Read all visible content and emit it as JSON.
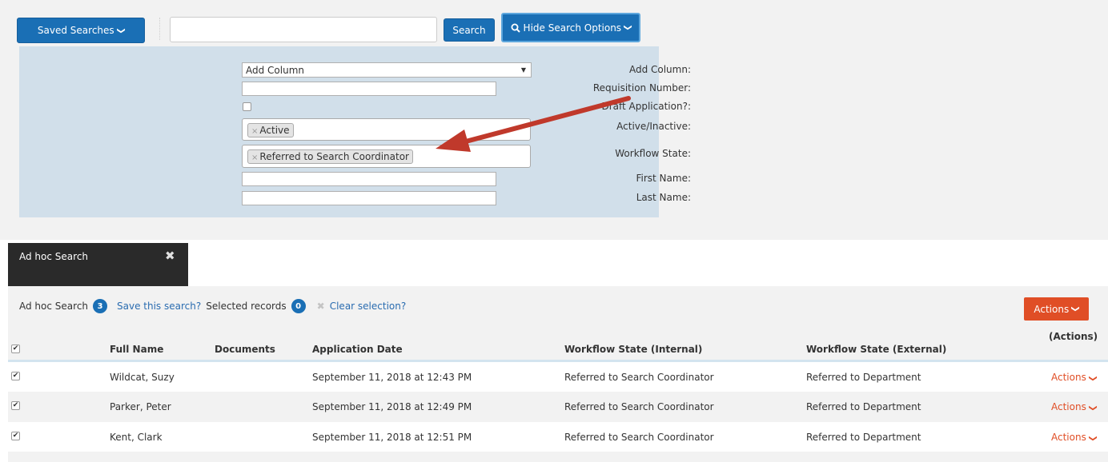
{
  "toolbar": {
    "saved_searches_label": "Saved Searches",
    "search_label": "Search",
    "hide_options_label": "Hide Search Options"
  },
  "search_panel": {
    "add_column_label": "Add Column:",
    "add_column_value": "Add Column",
    "requisition_label": "Requisition Number:",
    "draft_label": "Draft Application?:",
    "active_label": "Active/Inactive:",
    "active_tag": "Active",
    "workflow_label": "Workflow State:",
    "workflow_tag": "Referred to Search Coordinator",
    "first_name_label": "First Name:",
    "last_name_label": "Last Name:"
  },
  "tab": {
    "title": "Ad hoc Search"
  },
  "summary": {
    "label": "Ad hoc Search",
    "count": "3",
    "save_link": "Save this search?",
    "selected_label": "Selected records",
    "selected_count": "0",
    "clear_link": "Clear selection?"
  },
  "actions_button": "Actions",
  "table": {
    "headers": {
      "full_name": "Full Name",
      "documents": "Documents",
      "application_date": "Application Date",
      "workflow_internal": "Workflow State (Internal)",
      "workflow_external": "Workflow State (External)",
      "actions": "(Actions)"
    },
    "rows": [
      {
        "name": "Wildcat, Suzy",
        "date": "September 11, 2018 at 12:43 PM",
        "internal": "Referred to Search Coordinator",
        "external": "Referred to Department",
        "actions": "Actions"
      },
      {
        "name": "Parker, Peter",
        "date": "September 11, 2018 at 12:49 PM",
        "internal": "Referred to Search Coordinator",
        "external": "Referred to Department",
        "actions": "Actions"
      },
      {
        "name": "Kent, Clark",
        "date": "September 11, 2018 at 12:51 PM",
        "internal": "Referred to Search Coordinator",
        "external": "Referred to Department",
        "actions": "Actions"
      }
    ]
  },
  "colors": {
    "primary": "#1a6fb5",
    "panel": "#d1dfea",
    "danger": "#e04e26",
    "arrow": "#c0392b"
  }
}
